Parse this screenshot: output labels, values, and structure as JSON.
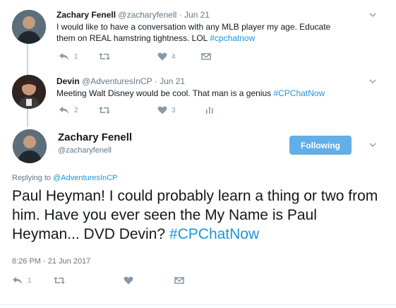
{
  "tweets": [
    {
      "name": "Zachary Fenell",
      "handle": "@zacharyfenell",
      "date": "· Jun 21",
      "text_line1": "I would like to have a conversation with any MLB player my age. Educate",
      "text_line2": "them on REAL hamstring tightness. LOL ",
      "hashtag": "#cpchatnow",
      "reply_count": "1",
      "like_count": "4"
    },
    {
      "name": "Devin",
      "handle": "@AdventuresInCP",
      "date": "· Jun 21",
      "text": "Meeting Walt Disney would be cool. That man is a genius ",
      "hashtag": "#CPChatNow",
      "reply_count": "2",
      "like_count": "3"
    }
  ],
  "main_tweet": {
    "name": "Zachary Fenell",
    "handle": "@zacharyfenell",
    "follow_label": "Following",
    "replying_prefix": "Replying to ",
    "replying_to": "@AdventuresInCP",
    "text": "Paul Heyman! I could probably learn a thing or two from him. Have you ever seen the My Name is Paul Heyman... DVD Devin? ",
    "hashtag": "#CPChatNow",
    "timestamp": "8:26 PM - 21 Jun 2017",
    "reply_count": "1"
  },
  "colors": {
    "link": "#1b95e0",
    "button": "#62aee8",
    "muted": "#657786"
  }
}
